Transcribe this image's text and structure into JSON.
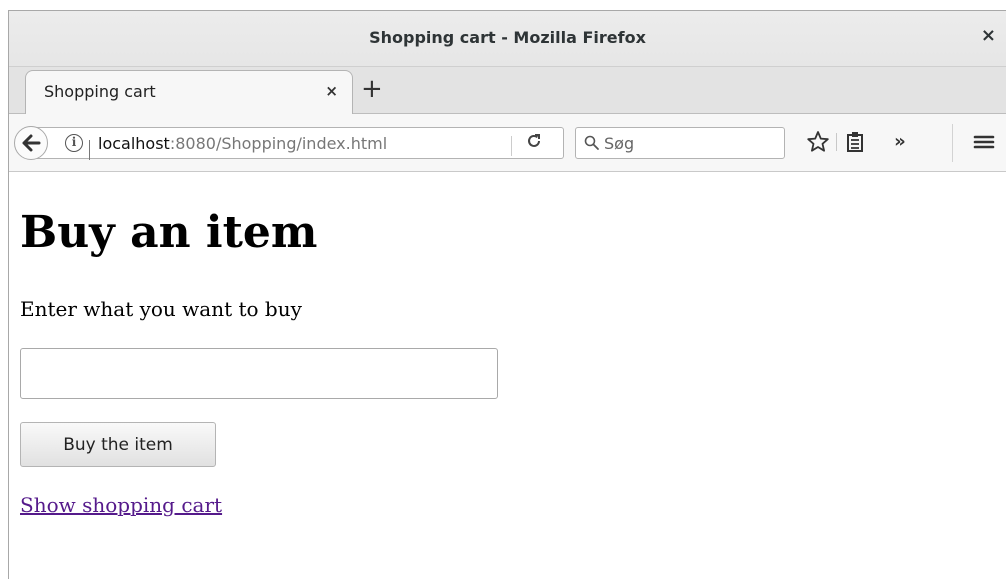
{
  "window": {
    "title": "Shopping cart - Mozilla Firefox",
    "close_label": "×"
  },
  "tabs": [
    {
      "label": "Shopping cart",
      "close_label": "×"
    }
  ],
  "new_tab_label": "+",
  "navbar": {
    "url_host": "localhost",
    "url_path": ":8080/Shopping/index.html",
    "search_placeholder": "Søg",
    "overflow_label": "»"
  },
  "page": {
    "heading": "Buy an item",
    "prompt": "Enter what you want to buy",
    "item_input_value": "",
    "buy_button_label": "Buy the item",
    "cart_link_label": "Show shopping cart"
  },
  "icons": {
    "back": "arrow-left-icon",
    "info": "info-icon",
    "reload": "reload-icon",
    "search": "search-icon",
    "bookmark": "star-icon",
    "reader": "clipboard-icon",
    "menu": "hamburger-icon"
  },
  "colors": {
    "visited_link": "#551a8b"
  }
}
